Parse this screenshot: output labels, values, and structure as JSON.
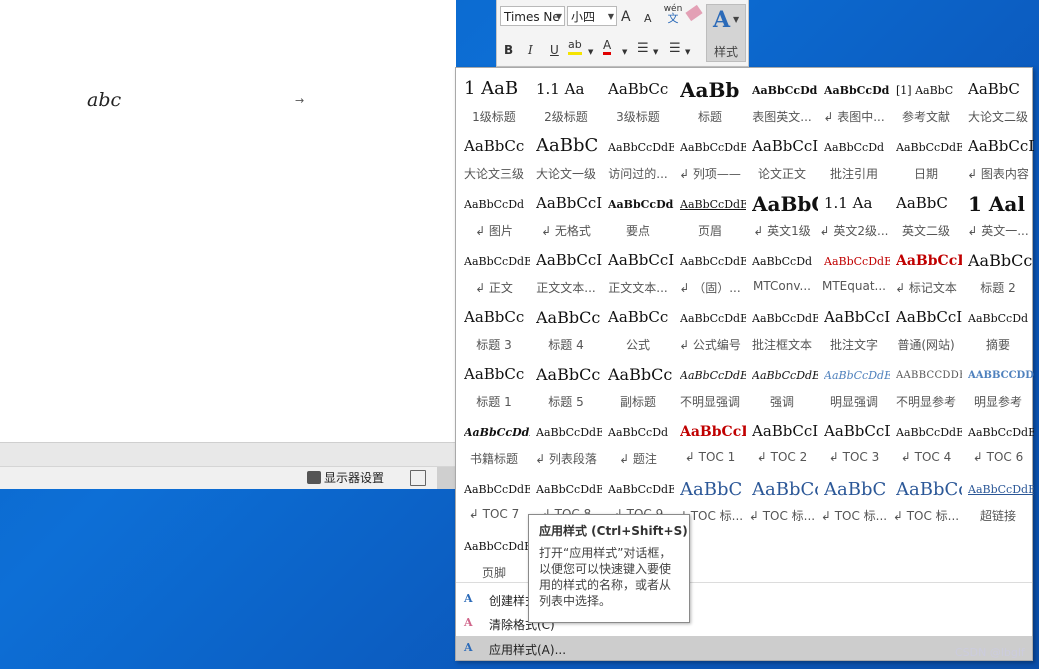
{
  "document": {
    "text": "abc",
    "arrow": "→"
  },
  "statusbar": {
    "display_settings": "显示器设置"
  },
  "toolbar": {
    "font_name": "Times Ne",
    "font_size": "小四",
    "grow_font": "A",
    "shrink_font": "A",
    "phonetic": "wén",
    "phonetic_char": "文",
    "bold": "B",
    "italic": "I",
    "underline": "U",
    "highlight": "ab",
    "font_color": "A",
    "styles_label": "样式",
    "styles_icon": "A"
  },
  "styles": [
    {
      "preview": "1  AaB",
      "name": "1级标题",
      "cls": "p1"
    },
    {
      "preview": "1.1  Aa",
      "name": "2级标题",
      "cls": "p2"
    },
    {
      "preview": "AaBbCc",
      "name": "3级标题",
      "cls": "p2"
    },
    {
      "preview": "AaBb",
      "name": "标题",
      "cls": "pbig"
    },
    {
      "preview": "AaBbCcDd",
      "name": "表图英文...",
      "cls": "pb"
    },
    {
      "preview": "AaBbCcDd",
      "name": "↲ 表图中...",
      "cls": "pb"
    },
    {
      "preview": "[1]  AaBbC",
      "name": "参考文献",
      "cls": "p3"
    },
    {
      "preview": "AaBbC",
      "name": "大论文二级",
      "cls": "p2"
    },
    {
      "preview": "AaBbCc",
      "name": "大论文三级",
      "cls": "p2"
    },
    {
      "preview": "AaBbC",
      "name": "大论文一级",
      "cls": "p1"
    },
    {
      "preview": "AaBbCcDdE",
      "name": "访问过的...",
      "cls": "p3"
    },
    {
      "preview": "AaBbCcDdE",
      "name": "↲ 列项——",
      "cls": "p3"
    },
    {
      "preview": "AaBbCcI",
      "name": "论文正文",
      "cls": "p2"
    },
    {
      "preview": "AaBbCcDd",
      "name": "批注引用",
      "cls": "p3"
    },
    {
      "preview": "AaBbCcDdE",
      "name": "日期",
      "cls": "p3"
    },
    {
      "preview": "AaBbCcDc",
      "name": "↲ 图表内容",
      "cls": "p2"
    },
    {
      "preview": "AaBbCcDd",
      "name": "↲ 图片",
      "cls": "p3"
    },
    {
      "preview": "AaBbCcI",
      "name": "↲ 无格式",
      "cls": "p2"
    },
    {
      "preview": "AaBbCcDdE",
      "name": "要点",
      "cls": "pb"
    },
    {
      "preview": "AaBbCcDdE",
      "name": "页眉",
      "cls": "pul"
    },
    {
      "preview": "AaBbC",
      "name": "↲ 英文1级",
      "cls": "pbig"
    },
    {
      "preview": "1.1  Aa",
      "name": "↲ 英文2级...",
      "cls": "p2"
    },
    {
      "preview": "AaBbC",
      "name": "英文二级",
      "cls": "p2"
    },
    {
      "preview": "1  Aal",
      "name": "↲ 英文一...",
      "cls": "pbig"
    },
    {
      "preview": "AaBbCcDdE",
      "name": "↲ 正文",
      "cls": "p3"
    },
    {
      "preview": "AaBbCcI",
      "name": "正文文本...",
      "cls": "p2"
    },
    {
      "preview": "AaBbCcI",
      "name": "正文文本...",
      "cls": "p2"
    },
    {
      "preview": "AaBbCcDdE",
      "name": "↲ （固）...",
      "cls": "p3"
    },
    {
      "preview": "AaBbCcDd",
      "name": "MTConv...",
      "cls": "p3"
    },
    {
      "preview": "AaBbCcDdE",
      "name": "MTEquat...",
      "cls": "pred"
    },
    {
      "preview": "AaBbCcI",
      "name": "↲ 标记文本",
      "cls": "predb"
    },
    {
      "preview": "AaBbCc",
      "name": "标题 2",
      "cls": "psans"
    },
    {
      "preview": "AaBbCc",
      "name": "标题 3",
      "cls": "p2"
    },
    {
      "preview": "AaBbCc",
      "name": "标题 4",
      "cls": "psans"
    },
    {
      "preview": "AaBbCc",
      "name": "公式",
      "cls": "p2"
    },
    {
      "preview": "AaBbCcDdE",
      "name": "↲ 公式编号",
      "cls": "p3"
    },
    {
      "preview": "AaBbCcDdE",
      "name": "批注框文本",
      "cls": "p3"
    },
    {
      "preview": "AaBbCcI",
      "name": "批注文字",
      "cls": "p2"
    },
    {
      "preview": "AaBbCcI",
      "name": "普通(网站)",
      "cls": "p2"
    },
    {
      "preview": "AaBbCcDd",
      "name": "摘要",
      "cls": "p3"
    },
    {
      "preview": "AaBbCc",
      "name": "标题 1",
      "cls": "p2"
    },
    {
      "preview": "AaBbCc",
      "name": "标题 5",
      "cls": "psans"
    },
    {
      "preview": "AaBbCc",
      "name": "副标题",
      "cls": "psans"
    },
    {
      "preview": "AaBbCcDdE",
      "name": "不明显强调",
      "cls": "pi"
    },
    {
      "preview": "AaBbCcDdE",
      "name": "强调",
      "cls": "pi"
    },
    {
      "preview": "AaBbCcDdE",
      "name": "明显强调",
      "cls": "pbluei"
    },
    {
      "preview": "AABBCCDDE",
      "name": "不明显参考",
      "cls": "psc"
    },
    {
      "preview": "AABBCCDDE",
      "name": "明显参考",
      "cls": "pscb"
    },
    {
      "preview": "AaBbCcDdE",
      "name": "书籍标题",
      "cls": "pbi"
    },
    {
      "preview": "AaBbCcDdE",
      "name": "↲ 列表段落",
      "cls": "p3"
    },
    {
      "preview": "AaBbCcDd",
      "name": "↲ 题注",
      "cls": "p3"
    },
    {
      "preview": "AaBbCcI",
      "name": "↲ TOC 1",
      "cls": "predb"
    },
    {
      "preview": "AaBbCcI",
      "name": "↲ TOC 2",
      "cls": "p2"
    },
    {
      "preview": "AaBbCcD",
      "name": "↲ TOC 3",
      "cls": "p2"
    },
    {
      "preview": "AaBbCcDdE",
      "name": "↲ TOC 4",
      "cls": "p3"
    },
    {
      "preview": "AaBbCcDdE",
      "name": "↲ TOC 6",
      "cls": "p3"
    },
    {
      "preview": "AaBbCcDdE",
      "name": "↲ TOC 7",
      "cls": "p3"
    },
    {
      "preview": "AaBbCcDdE",
      "name": "↲ TOC 8",
      "cls": "p3"
    },
    {
      "preview": "AaBbCcDdE",
      "name": "↲ TOC 9",
      "cls": "p3"
    },
    {
      "preview": "AaBbC",
      "name": "↲ TOC 标...",
      "cls": "pblue"
    },
    {
      "preview": "AaBbCc",
      "name": "↲ TOC 标...",
      "cls": "pblue"
    },
    {
      "preview": "AaBbC",
      "name": "↲ TOC 标...",
      "cls": "pblue"
    },
    {
      "preview": "AaBbCc",
      "name": "↲ TOC 标...",
      "cls": "pblue"
    },
    {
      "preview": "AaBbCcDdE",
      "name": "超链接",
      "cls": "plink"
    },
    {
      "preview": "AaBbCcDdE",
      "name": "页脚",
      "cls": "p3"
    }
  ],
  "menu": {
    "create": "创建样式(S)",
    "clear": "清除格式(C)",
    "apply": "应用样式(A)..."
  },
  "tooltip": {
    "title": "应用样式 (Ctrl+Shift+S)",
    "body": "打开“应用样式”对话框，以便您可以快速键入要使用的样式的名称，或者从列表中选择。"
  },
  "watermark": "CSDN @lbglf"
}
